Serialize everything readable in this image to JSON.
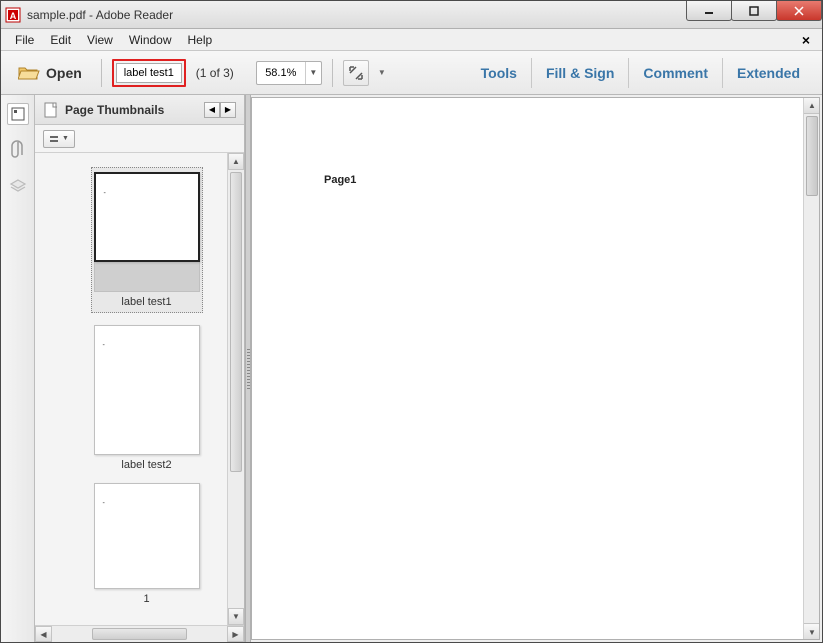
{
  "title": "sample.pdf - Adobe Reader",
  "menu": {
    "file": "File",
    "edit": "Edit",
    "view": "View",
    "window": "Window",
    "help": "Help"
  },
  "toolbar": {
    "open_label": "Open",
    "page_input": "label test1",
    "page_count": "(1 of 3)",
    "zoom": "58.1%"
  },
  "rightlinks": {
    "tools": "Tools",
    "fillsign": "Fill & Sign",
    "comment": "Comment",
    "extended": "Extended"
  },
  "panel": {
    "title": "Page Thumbnails",
    "thumbs": [
      {
        "label": "label test1",
        "mini": "-",
        "selected": true
      },
      {
        "label": "label test2",
        "mini": "-",
        "selected": false
      },
      {
        "label": "1",
        "mini": "-",
        "selected": false
      }
    ]
  },
  "document": {
    "page_text": "Page1"
  }
}
